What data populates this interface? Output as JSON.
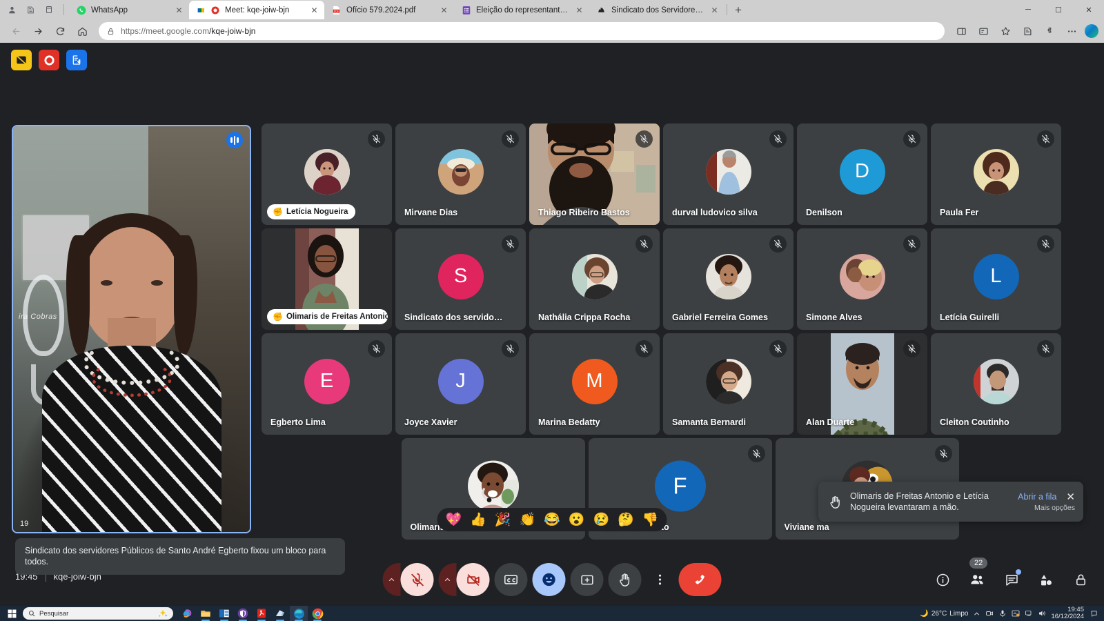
{
  "browser": {
    "tabs": [
      {
        "title": "WhatsApp",
        "favicon": "whatsapp-icon",
        "active": false
      },
      {
        "title": "Meet: kqe-joiw-bjn",
        "favicon": "google-meet-icon",
        "active": true
      },
      {
        "title": "Ofício 579.2024.pdf",
        "favicon": "pdf-icon",
        "active": false
      },
      {
        "title": "Eleição do representante da Com",
        "favicon": "google-forms-icon",
        "active": false
      },
      {
        "title": "Sindicato dos Servidores Públicos",
        "favicon": "site-icon",
        "active": false
      }
    ],
    "new_tab_label": "+",
    "close_label": "✕",
    "url_scheme": "https://meet.google.com",
    "url_path": "/kqe-joiw-bjn",
    "window_controls": {
      "minimize": "─",
      "maximize": "☐",
      "close": "✕"
    }
  },
  "extension_toolbar": [
    {
      "name": "blur-background-off-button",
      "color": "#f5c518"
    },
    {
      "name": "record-button",
      "color": "#e03127"
    },
    {
      "name": "export-attendance-button",
      "color": "#1a73e8"
    }
  ],
  "self_tile": {
    "pin_banner": "Sindicato dos servidores Públicos de Santo André Egberto fixou um bloco para todos.",
    "corner_time": "19"
  },
  "grid": {
    "rows": [
      [
        {
          "name": "Letícia Nogueira",
          "muted": true,
          "hand_raised": true,
          "avatar_type": "photo",
          "avatar_class": "av-leticia"
        },
        {
          "name": "Mirvane Dias",
          "muted": true,
          "hand_raised": false,
          "avatar_type": "photo",
          "avatar_class": "av-mirvane"
        },
        {
          "name": "Thiago Ribeiro Bastos",
          "muted": true,
          "hand_raised": false,
          "avatar_type": "video",
          "avatar_class": "vid-thiago"
        },
        {
          "name": "durval ludovico silva",
          "muted": true,
          "hand_raised": false,
          "avatar_type": "photo",
          "avatar_class": "av-durval"
        },
        {
          "name": "Denilson",
          "muted": true,
          "hand_raised": false,
          "avatar_type": "initial",
          "initial": "D",
          "color": "#1e9bd7"
        },
        {
          "name": "Paula Fer",
          "muted": true,
          "hand_raised": false,
          "avatar_type": "photo",
          "avatar_class": "av-paula"
        }
      ],
      [
        {
          "name": "Olimaris de Freitas Antonio",
          "muted": false,
          "hand_raised": true,
          "avatar_type": "video",
          "avatar_class": "vid-olimaris"
        },
        {
          "name": "Sindicato dos servidores Pú...",
          "muted": true,
          "hand_raised": false,
          "avatar_type": "initial",
          "initial": "S",
          "color": "#e0245e"
        },
        {
          "name": "Nathália Crippa Rocha",
          "muted": true,
          "hand_raised": false,
          "avatar_type": "photo",
          "avatar_class": "av-nathalia"
        },
        {
          "name": "Gabriel Ferreira Gomes",
          "muted": true,
          "hand_raised": false,
          "avatar_type": "photo",
          "avatar_class": "av-gabriel"
        },
        {
          "name": "Simone Alves",
          "muted": true,
          "hand_raised": false,
          "avatar_type": "photo",
          "avatar_class": "av-simone"
        },
        {
          "name": "Letícia Guirelli",
          "muted": true,
          "hand_raised": false,
          "avatar_type": "initial",
          "initial": "L",
          "color": "#1367b8"
        }
      ],
      [
        {
          "name": "Egberto Lima",
          "muted": true,
          "hand_raised": false,
          "avatar_type": "initial",
          "initial": "E",
          "color": "#e8397b"
        },
        {
          "name": "Joyce Xavier",
          "muted": true,
          "hand_raised": false,
          "avatar_type": "initial",
          "initial": "J",
          "color": "#6572d6"
        },
        {
          "name": "Marina Bedatty",
          "muted": true,
          "hand_raised": false,
          "avatar_type": "initial",
          "initial": "M",
          "color": "#f05a1e"
        },
        {
          "name": "Samanta Bernardi",
          "muted": true,
          "hand_raised": false,
          "avatar_type": "photo",
          "avatar_class": "av-samanta"
        },
        {
          "name": "Alan Duarte",
          "muted": true,
          "hand_raised": false,
          "avatar_type": "video",
          "avatar_class": "vid-alan"
        },
        {
          "name": "Cleiton Coutinho",
          "muted": true,
          "hand_raised": false,
          "avatar_type": "photo",
          "avatar_class": "av-cleiton"
        }
      ],
      [
        {
          "name": "Olimaris de Freitas Antonio",
          "muted": false,
          "hand_raised": false,
          "avatar_type": "photo",
          "avatar_class": "av-olimaris2",
          "wide": true
        },
        {
          "name": "Flavia Chiomento",
          "muted": true,
          "hand_raised": false,
          "avatar_type": "initial",
          "initial": "F",
          "color": "#1367b8",
          "wide": true
        },
        {
          "name": "Viviane ma",
          "muted": true,
          "hand_raised": false,
          "avatar_type": "photo",
          "avatar_class": "av-viviane",
          "wide": true
        }
      ]
    ]
  },
  "toast": {
    "icon": "raised-hand-icon",
    "message": "Olimaris de Freitas Antonio e Letícia Nogueira levantaram a mão.",
    "action": "Abrir a fila",
    "more": "Mais opções",
    "close": "✕"
  },
  "reactions": [
    "💖",
    "👍",
    "🎉",
    "👏",
    "😂",
    "😮",
    "😢",
    "🤔",
    "👎"
  ],
  "bottom_bar": {
    "time": "19:45",
    "meeting_code": "kqe-joiw-bjn",
    "controls": [
      {
        "name": "mic-options-chevron",
        "label": "^"
      },
      {
        "name": "microphone-off-button",
        "label": "mic-off-icon"
      },
      {
        "name": "camera-options-chevron",
        "label": "^"
      },
      {
        "name": "camera-off-button",
        "label": "camera-off-icon"
      },
      {
        "name": "captions-button",
        "label": "cc-icon"
      },
      {
        "name": "reactions-button",
        "label": "emoji-icon"
      },
      {
        "name": "present-screen-button",
        "label": "present-icon"
      },
      {
        "name": "raise-hand-button",
        "label": "hand-icon"
      },
      {
        "name": "more-options-button",
        "label": "more-vertical-icon"
      },
      {
        "name": "end-call-button",
        "label": "end-call-icon"
      }
    ],
    "right_controls": [
      {
        "name": "meeting-details-button",
        "icon": "info-icon"
      },
      {
        "name": "people-button",
        "icon": "people-icon",
        "count": "22"
      },
      {
        "name": "chat-button",
        "icon": "chat-icon",
        "has_dot": true
      },
      {
        "name": "activities-button",
        "icon": "shapes-icon"
      },
      {
        "name": "host-controls-button",
        "icon": "lock-icon"
      }
    ]
  },
  "taskbar": {
    "search_placeholder": "Pesquisar",
    "weather_temp": "26°C",
    "weather_desc": "Limpo",
    "clock_time": "19:45",
    "clock_date": "16/12/2024",
    "apps": [
      {
        "name": "copilot-icon"
      },
      {
        "name": "file-explorer-icon"
      },
      {
        "name": "outlook-icon"
      },
      {
        "name": "bitwarden-icon"
      },
      {
        "name": "acrobat-reader-icon"
      },
      {
        "name": "onedrive-icon"
      },
      {
        "name": "microsoft-edge-icon"
      },
      {
        "name": "chrome-icon"
      }
    ]
  }
}
